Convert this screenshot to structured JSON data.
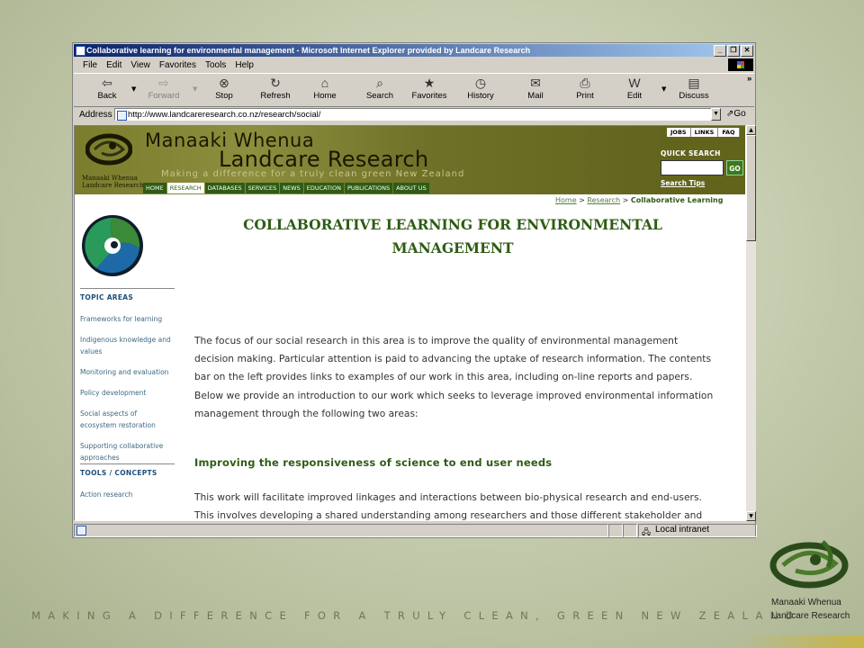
{
  "window": {
    "title": "Collaborative learning for environmental management - Microsoft Internet Explorer provided by Landcare Research",
    "minimize": "_",
    "maximize": "❐",
    "close": "✕"
  },
  "menu": [
    "File",
    "Edit",
    "View",
    "Favorites",
    "Tools",
    "Help"
  ],
  "toolbar": {
    "back": "Back",
    "forward": "Forward",
    "stop": "Stop",
    "refresh": "Refresh",
    "home": "Home",
    "search": "Search",
    "favorites": "Favorites",
    "history": "History",
    "mail": "Mail",
    "print": "Print",
    "edit": "Edit",
    "discuss": "Discuss",
    "more": "»"
  },
  "address": {
    "label": "Address",
    "url": "http://www.landcareresearch.co.nz/research/social/",
    "go": "Go"
  },
  "status": {
    "zone": "Local intranet"
  },
  "site": {
    "brand_small_1": "Manaaki Whenua",
    "brand_small_2": "Landcare Research",
    "brand_line1": "Manaaki Whenua",
    "brand_line2": "Landcare Research",
    "tagline": "Making a difference for a truly clean green New Zealand",
    "nav": [
      "HOME",
      "RESEARCH",
      "DATABASES",
      "SERVICES",
      "NEWS",
      "EDUCATION",
      "PUBLICATIONS",
      "ABOUT US"
    ],
    "toplinks": [
      "JOBS",
      "LINKS",
      "FAQ"
    ],
    "quick_search": "QUICK SEARCH",
    "go": "GO",
    "search_tips": "Search Tips"
  },
  "breadcrumb": {
    "home": "Home",
    "sep1": " > ",
    "research": "Research",
    "sep2": " > ",
    "current": "Collaborative Learning"
  },
  "sidebar": {
    "topic_heading": "TOPIC AREAS",
    "topics": [
      "Frameworks for learning",
      "Indigenous knowledge and values",
      "Monitoring and evaluation",
      "Policy development",
      "Social aspects of ecosystem restoration",
      "Supporting collaborative approaches"
    ],
    "tools_heading": "TOOLS / CONCEPTS",
    "tools": [
      "Action research"
    ]
  },
  "content": {
    "title": "COLLABORATIVE LEARNING FOR ENVIRONMENTAL MANAGEMENT",
    "intro": "The focus of our social research in this area is to improve the quality of environmental management decision making. Particular attention is paid to advancing the uptake of research information. The contents bar on the left provides links to examples of our work in this area, including on-line reports and papers. Below we provide an introduction to our work which seeks to leverage improved environmental information management through the following two areas:",
    "subheading": "Improving the responsiveness of science to end user needs",
    "para2": "This work will facilitate improved linkages and interactions between bio-physical research and end-users. This involves developing a shared understanding among researchers and those different stakeholder and tangata whenua representatives that they engage with, helping to ensure that the resulting science is most relevant and responsive to end-user"
  },
  "slide": {
    "tagline": "MAKING A DIFFERENCE FOR A TRULY CLEAN, GREEN NEW ZEALAND",
    "logo_line1": "Manaaki Whenua",
    "logo_line2": "Landcare Research"
  }
}
